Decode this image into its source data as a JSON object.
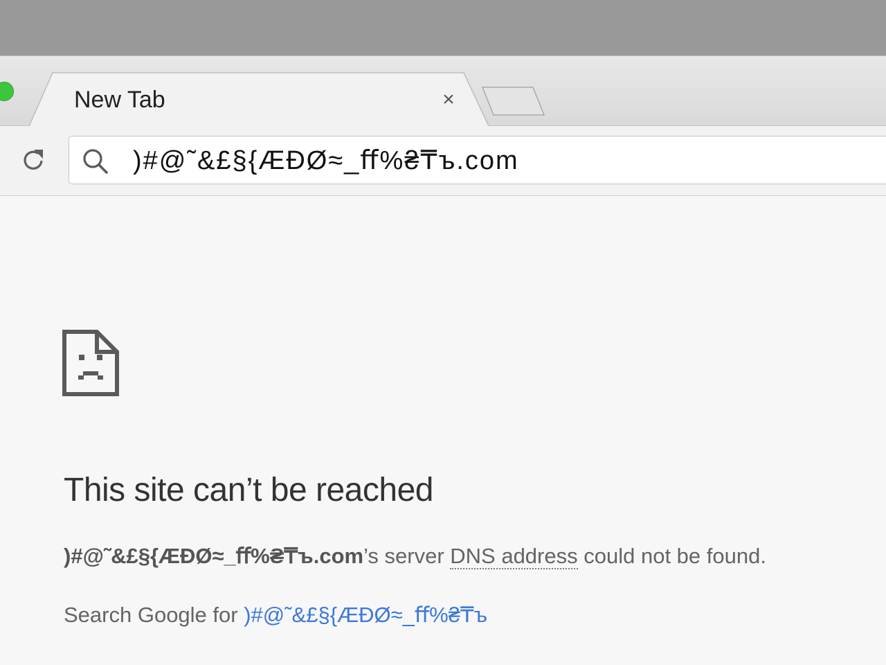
{
  "browser": {
    "tab": {
      "title": "New Tab",
      "close_glyph": "×"
    },
    "omnibox": {
      "value": ")#@˜&£§{ÆĐØ≈_ﬀ%₴₸ъ.com",
      "search_icon": "search-icon"
    },
    "toolbar": {
      "reload_icon": "reload-icon"
    }
  },
  "error_page": {
    "icon": "sad-page-icon",
    "heading": "This site can’t be reached",
    "detail": {
      "domain": ")#@˜&£§{ÆĐØ≈_ﬀ%₴₸ъ.com",
      "text_before_dns": "’s server ",
      "dns_link": "DNS address",
      "text_after_dns": " could not be found."
    },
    "search": {
      "prefix": "Search Google for ",
      "query": ")#@˜&£§{ÆĐØ≈_ﬀ%₴₸ъ"
    }
  },
  "colors": {
    "link": "#3d78d8",
    "heading": "#333333",
    "body_text": "#646464",
    "page_background": "#f7f7f7",
    "traffic_light_green": "#3ec53e"
  }
}
